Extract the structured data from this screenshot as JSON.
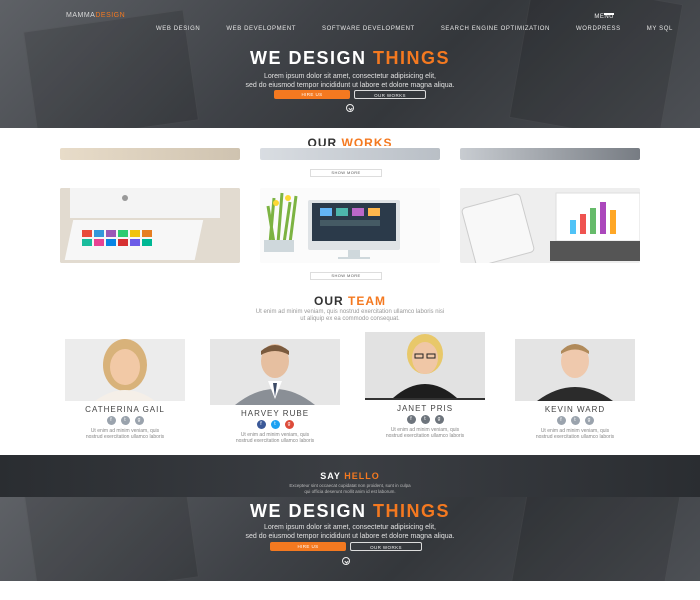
{
  "brand": {
    "logo_left": "MAMMA",
    "logo_right": "DESIGN"
  },
  "nav": {
    "items": [
      "WEB DESIGN",
      "WEB DEVELOPMENT",
      "SOFTWARE DEVELOPMENT",
      "SEARCH ENGINE OPTIMIZATION",
      "WORDPRESS",
      "MY SQL"
    ],
    "menu_label": "MENU"
  },
  "hero": {
    "title_white": "WE DESIGN",
    "title_accent": "THINGS",
    "subtitle_line1": "Lorem ipsum dolor sit amet, consectetur adipisicing elit,",
    "subtitle_line2": "sed do eiusmod tempor incididunt ut labore et dolore magna aliqua.",
    "hire_label": "HIRE US",
    "works_label": "OUR WORKS"
  },
  "works": {
    "title_white": "OUR",
    "title_accent": "WORKS",
    "show_more": "SHOW MORE"
  },
  "team": {
    "title_white": "OUR",
    "title_accent": "TEAM",
    "subtitle_line1": "Ut enim ad minim veniam, quis nostrud exercitation ullamco laboris nisi",
    "subtitle_line2": "ut aliquip ex ea commodo consequat.",
    "members": [
      {
        "name": "CATHERINA GAIL",
        "desc1": "Ut enim ad minim veniam, quis",
        "desc2": "nostrud exercitation ullamco laboris"
      },
      {
        "name": "HARVEY RUBE",
        "desc1": "Ut enim ad minim veniam, quis",
        "desc2": "nostrud exercitation ullamco laboris"
      },
      {
        "name": "JANET PRIS",
        "desc1": "Ut enim ad minim veniam, quis",
        "desc2": "nostrud exercitation ullamco laboris"
      },
      {
        "name": "KEVIN WARD",
        "desc1": "Ut enim ad minim veniam, quis",
        "desc2": "nostrud exercitation ullamco laboris"
      }
    ]
  },
  "hello": {
    "title_white": "SAY",
    "title_accent": "HELLO",
    "line1": "Excepteur sint occaecat cupidatat non proident, sunt in culpa",
    "line2": "qui officia deserunt mollit anim id est laborum."
  },
  "colors": {
    "accent": "#f47920",
    "facebook": "#3b5998",
    "twitter": "#1da1f2",
    "googleplus": "#dd4b39"
  }
}
